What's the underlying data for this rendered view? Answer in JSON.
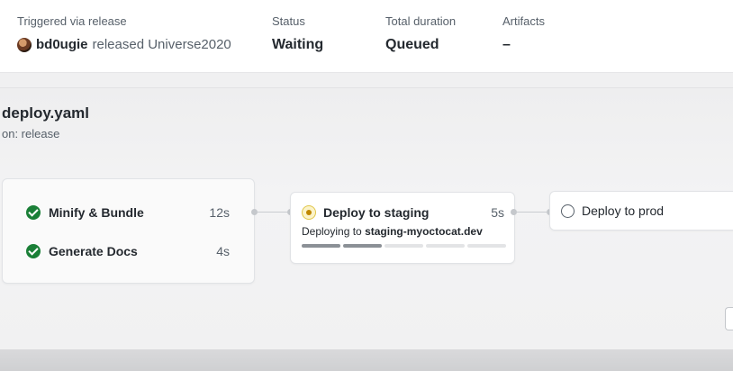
{
  "summary": {
    "trigger_label": "Triggered via release",
    "actor": "bd0ugie",
    "trigger_text": "released Universe2020",
    "status_label": "Status",
    "status_value": "Waiting",
    "duration_label": "Total duration",
    "duration_value": "Queued",
    "artifacts_label": "Artifacts",
    "artifacts_value": "–"
  },
  "workflow": {
    "file": "deploy.yaml",
    "trigger": "on: release"
  },
  "jobs_group": [
    {
      "name": "Minify & Bundle",
      "duration": "12s",
      "status": "success",
      "icon": "check-circle-icon"
    },
    {
      "name": "Generate Docs",
      "duration": "4s",
      "status": "success",
      "icon": "check-circle-icon"
    }
  ],
  "staging": {
    "name": "Deploy to staging",
    "duration": "5s",
    "status": "in_progress",
    "icon": "pending-dot-icon",
    "step_prefix": "Deploying to",
    "step_target": "staging-myoctocat.dev",
    "progress_fraction": 0.4
  },
  "prod": {
    "name": "Deploy to prod",
    "status": "queued",
    "icon": "empty-circle-icon"
  },
  "colors": {
    "success": "#1a7f37",
    "pending": "#bf8700",
    "muted": "#57606a"
  }
}
